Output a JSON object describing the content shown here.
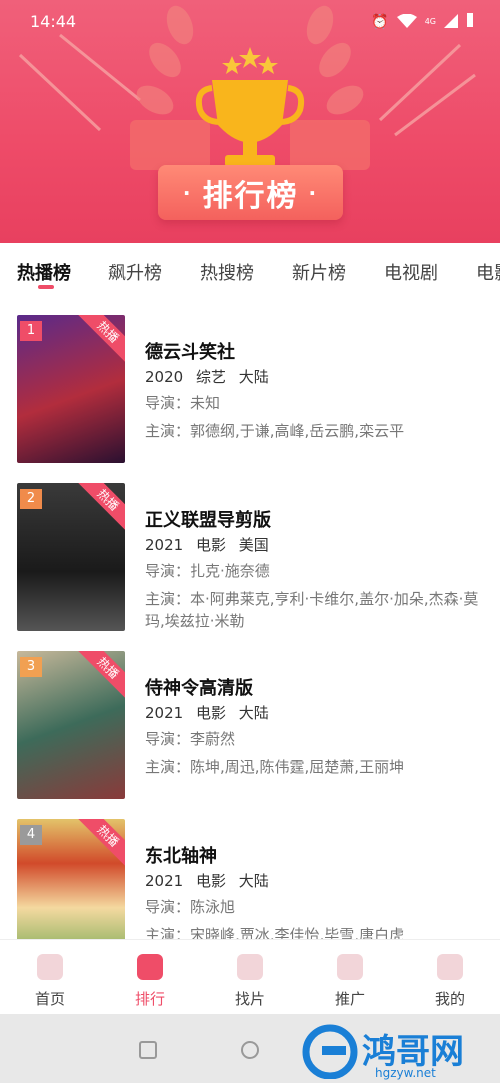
{
  "status": {
    "time": "14:44",
    "net": "4G"
  },
  "hero": {
    "title": "排行榜",
    "dot": "·"
  },
  "tabs": [
    "热播榜",
    "飙升榜",
    "热搜榜",
    "新片榜",
    "电视剧",
    "电影"
  ],
  "items": [
    {
      "rank": "1",
      "badge": "热播",
      "title": "德云斗笑社",
      "year": "2020",
      "genre": "综艺",
      "region": "大陆",
      "director": "导演：未知",
      "cast": "主演：郭德纲,于谦,高峰,岳云鹏,栾云平",
      "poster_color": "#b22d3d",
      "rank_color": "#ef4d68"
    },
    {
      "rank": "2",
      "badge": "热播",
      "title": "正义联盟导剪版",
      "year": "2021",
      "genre": "电影",
      "region": "美国",
      "director": "导演：扎克·施奈德",
      "cast": "主演：本·阿弗莱克,亨利·卡维尔,盖尔·加朵,杰森·莫玛,埃兹拉·米勒",
      "poster_color": "#222222",
      "rank_color": "#f08b4b"
    },
    {
      "rank": "3",
      "badge": "热播",
      "title": "侍神令高清版",
      "year": "2021",
      "genre": "电影",
      "region": "大陆",
      "director": "导演：李蔚然",
      "cast": "主演：陈坤,周迅,陈伟霆,屈楚萧,王丽坤",
      "poster_color": "#3d6b5a",
      "rank_color": "#f1a052"
    },
    {
      "rank": "4",
      "badge": "热播",
      "title": "东北轴神",
      "year": "2021",
      "genre": "电影",
      "region": "大陆",
      "director": "导演：陈泳旭",
      "cast": "主演：宋晓峰,贾冰,李佳怡,毕雪,唐白虎",
      "poster_color": "#e3c36a",
      "rank_color": "#9a9a9a"
    }
  ],
  "bottom_nav": [
    "首页",
    "排行",
    "找片",
    "推广",
    "我的"
  ],
  "watermark": {
    "name": "鸿哥网",
    "url": "hgzyw.net"
  }
}
